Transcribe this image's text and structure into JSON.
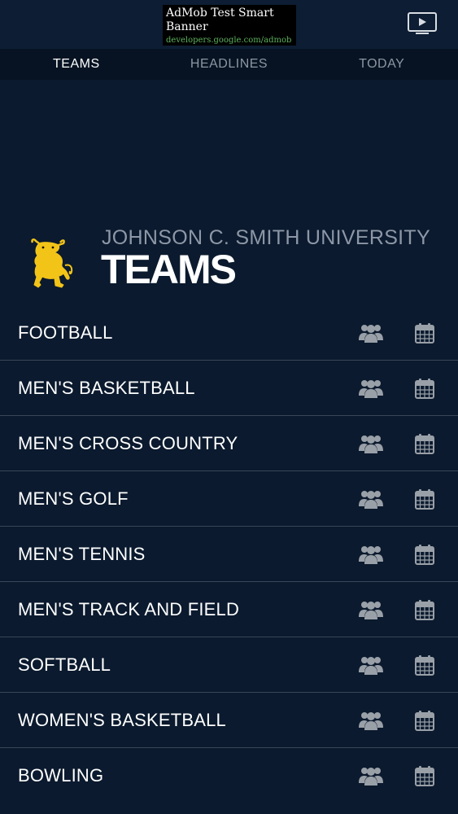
{
  "ad": {
    "title": "AdMob Test Smart Banner",
    "url": "developers.google.com/admob"
  },
  "tabs": [
    {
      "label": "TEAMS",
      "active": true
    },
    {
      "label": "HEADLINES",
      "active": false
    },
    {
      "label": "TODAY",
      "active": false
    }
  ],
  "banner": {
    "school": "JOHNSON C. SMITH UNIVERSITY",
    "heading": "TEAMS"
  },
  "teams": [
    {
      "name": "FOOTBALL"
    },
    {
      "name": "MEN'S BASKETBALL"
    },
    {
      "name": "MEN'S CROSS COUNTRY"
    },
    {
      "name": "MEN'S GOLF"
    },
    {
      "name": "MEN'S TENNIS"
    },
    {
      "name": "MEN'S TRACK AND FIELD"
    },
    {
      "name": "SOFTBALL"
    },
    {
      "name": "WOMEN'S BASKETBALL"
    },
    {
      "name": "BOWLING"
    }
  ],
  "colors": {
    "background": "#0b1a2e",
    "tab_bar": "#071322",
    "accent_gold": "#f2c418",
    "icon_gray": "#9aa0a8"
  },
  "icons": {
    "cast": "tv-play-icon",
    "roster": "group-icon",
    "schedule": "calendar-icon",
    "logo": "golden-bull-logo"
  }
}
